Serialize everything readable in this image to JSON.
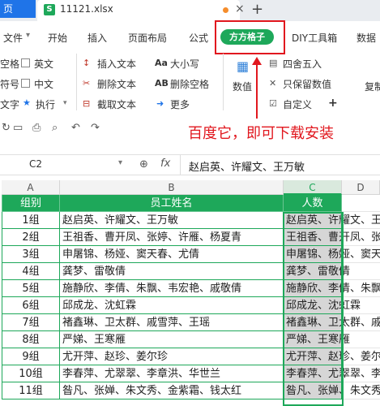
{
  "tabs": {
    "home_partial": "页",
    "file_name": "11121.xlsx",
    "close": "×",
    "add": "+"
  },
  "menu": {
    "file": "文件",
    "dropdown": "▾",
    "items": [
      "开始",
      "插入",
      "页面布局",
      "公式"
    ],
    "active_plugin": "方方格子",
    "diy": "DIY工具箱",
    "data": "数据"
  },
  "ribbon": {
    "left_labels": [
      "空格",
      "符号",
      "文字"
    ],
    "checkboxes": [
      "英文",
      "中文"
    ],
    "execute": "执行",
    "insert_text": "插入文本",
    "delete_text": "删除文本",
    "extract_text": "截取文本",
    "case": "大小写",
    "delete_space": "删除空格",
    "more": "更多",
    "number": "数值",
    "round": "四舍五入",
    "keep_number": "只保留数值",
    "custom": "自定义",
    "copy_partial": "复制"
  },
  "annotation": {
    "text": "百度它，即可下载安装",
    "color": "#e1171e"
  },
  "formula_bar": {
    "cell_ref": "C2",
    "fx": "fx",
    "content": "赵启英、许耀文、王万敏"
  },
  "columns": [
    "A",
    "B",
    "C",
    "D"
  ],
  "table": {
    "headers": [
      "组别",
      "员工姓名",
      "人数"
    ],
    "rows": [
      {
        "group": "1组",
        "names": "赵启英、许耀文、王万敏",
        "count": "赵启英、许耀文、王万敏"
      },
      {
        "group": "2组",
        "names": "王祖香、曹开凤、张婷、许雁、杨夏青",
        "count": "王祖香、曹开凤、张婷、许雁、杨夏青"
      },
      {
        "group": "3组",
        "names": "申屠锦、杨娅、窦天春、尤倩",
        "count": "申屠锦、杨娅、窦天春、尤倩"
      },
      {
        "group": "4组",
        "names": "龚梦、雷敬倩",
        "count": "龚梦、雷敬倩"
      },
      {
        "group": "5组",
        "names": "施静欣、李倩、朱飘、韦宏艳、戚敬倩",
        "count": "施静欣、李倩、朱飘、韦宏艳、戚敬倩"
      },
      {
        "group": "6组",
        "names": "邱成龙、沈虹霖",
        "count": "邱成龙、沈虹霖"
      },
      {
        "group": "7组",
        "names": "褚鑫琳、卫太群、戚雪萍、王瑶",
        "count": "褚鑫琳、卫太群、戚雪萍、王瑶"
      },
      {
        "group": "8组",
        "names": "严娣、王寒雁",
        "count": "严娣、王寒雁"
      },
      {
        "group": "9组",
        "names": "尤开萍、赵珍、姜尔珍",
        "count": "尤开萍、赵珍、姜尔珍"
      },
      {
        "group": "10组",
        "names": "李春萍、尤翠翠、李章洪、华世兰",
        "count": "李春萍、尤翠翠、李章洪、华世兰"
      },
      {
        "group": "11组",
        "names": "昝凡、张婵、朱文秀、金紫霜、钱太红",
        "count": "昝凡、张婵、朱文秀、金紫霜、钱太红"
      }
    ]
  },
  "colors": {
    "accent": "#1ea85a",
    "red": "#e1171e",
    "selected_fill": "#d6d6d6"
  }
}
